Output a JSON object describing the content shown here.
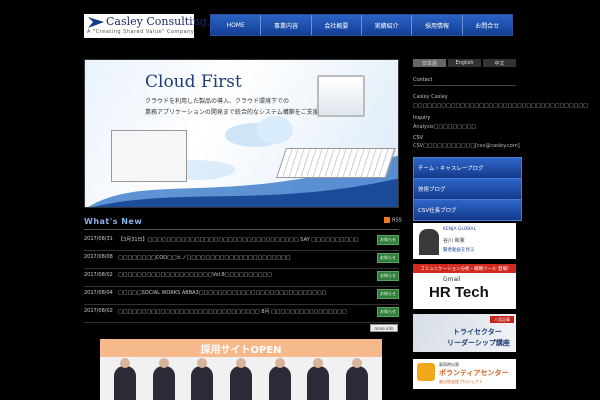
{
  "header": {
    "logo_name": "Casley Consulting, Inc.",
    "logo_tagline": "A \"Creating Shared Value\" Company",
    "nav": [
      "HOME",
      "事業内容",
      "会社概要",
      "実績紹介",
      "採用情報",
      "お問合せ"
    ]
  },
  "hero": {
    "title": "Cloud First",
    "lines": [
      "クラウドを利用した製品の導入、クラウド環境下での",
      "業務アプリケーションの開発まで統合的なシステム構築をご支援しております。"
    ]
  },
  "news": {
    "title": "What's New",
    "rss_label": "RSS",
    "more_label": "more info",
    "items": [
      {
        "date": "2017/08/31",
        "text": "【3月31日】□□□□□□□□□□□□□□□□□□□□□□□□□□□□□□□□ SAY □□□□□□□□□□□□□□□□□□□",
        "badge": "お知らせ"
      },
      {
        "date": "2017/08/08",
        "text": "□□□□□□□□COO□□ヒノ□□□□□□□□□□□□□□□□□□□□□□",
        "badge": "お知らせ"
      },
      {
        "date": "2017/08/02",
        "text": "□□□□□□□□□□□□□□□□□□□□Vol.8□□□□□□□□□□",
        "badge": "お知らせ"
      },
      {
        "date": "2017/08/04",
        "text": "□□□□□SOCIAL WORKS ABBA3□□□□□□□□□□□□□□□□□□□□□□□□□□□",
        "badge": "お知らせ"
      },
      {
        "date": "2017/08/02",
        "text": "□□□□□□□□□□□□□□□□□□□□□□□□□□□□□□ 8月 □□□□□□□□□□□□□□□□",
        "badge": "お知らせ"
      }
    ]
  },
  "recruit": {
    "title": "採用サイトOPEN"
  },
  "sidebar": {
    "langs": [
      "日本語",
      "English",
      "中文"
    ],
    "sections": [
      {
        "head": "Contact",
        "text": "Casley Casley"
      },
      {
        "head": "Inquiry",
        "text": "□□□□□□□□□□□□□□□□□□□□□□□□□□□□□□□□□□□□□"
      },
      {
        "head": "CSV",
        "text": "CSV□□□□□□□□□□□[csv@casley.com]"
      }
    ],
    "blogs": [
      "チーム・キャスレーブログ",
      "技術ブログ",
      "CSV社長ブログ"
    ],
    "kenja": {
      "t1": "KENJA GLOBAL",
      "t2": "谷川 和憲",
      "t3": "賢者動画を見る"
    },
    "hrtech": {
      "top": "コミュニケーション分析・戦略ツール 登場!",
      "gmail": "Gmail",
      "title": "HR Tech"
    },
    "tri": {
      "tag": "人気記事",
      "line1": "トライセクター",
      "line2": "リーダーシップ講座"
    },
    "vol": {
      "t1": "豪雨時災害",
      "t2": "ボランティアセンター",
      "t3": "被災地支援プロジェクト"
    }
  }
}
